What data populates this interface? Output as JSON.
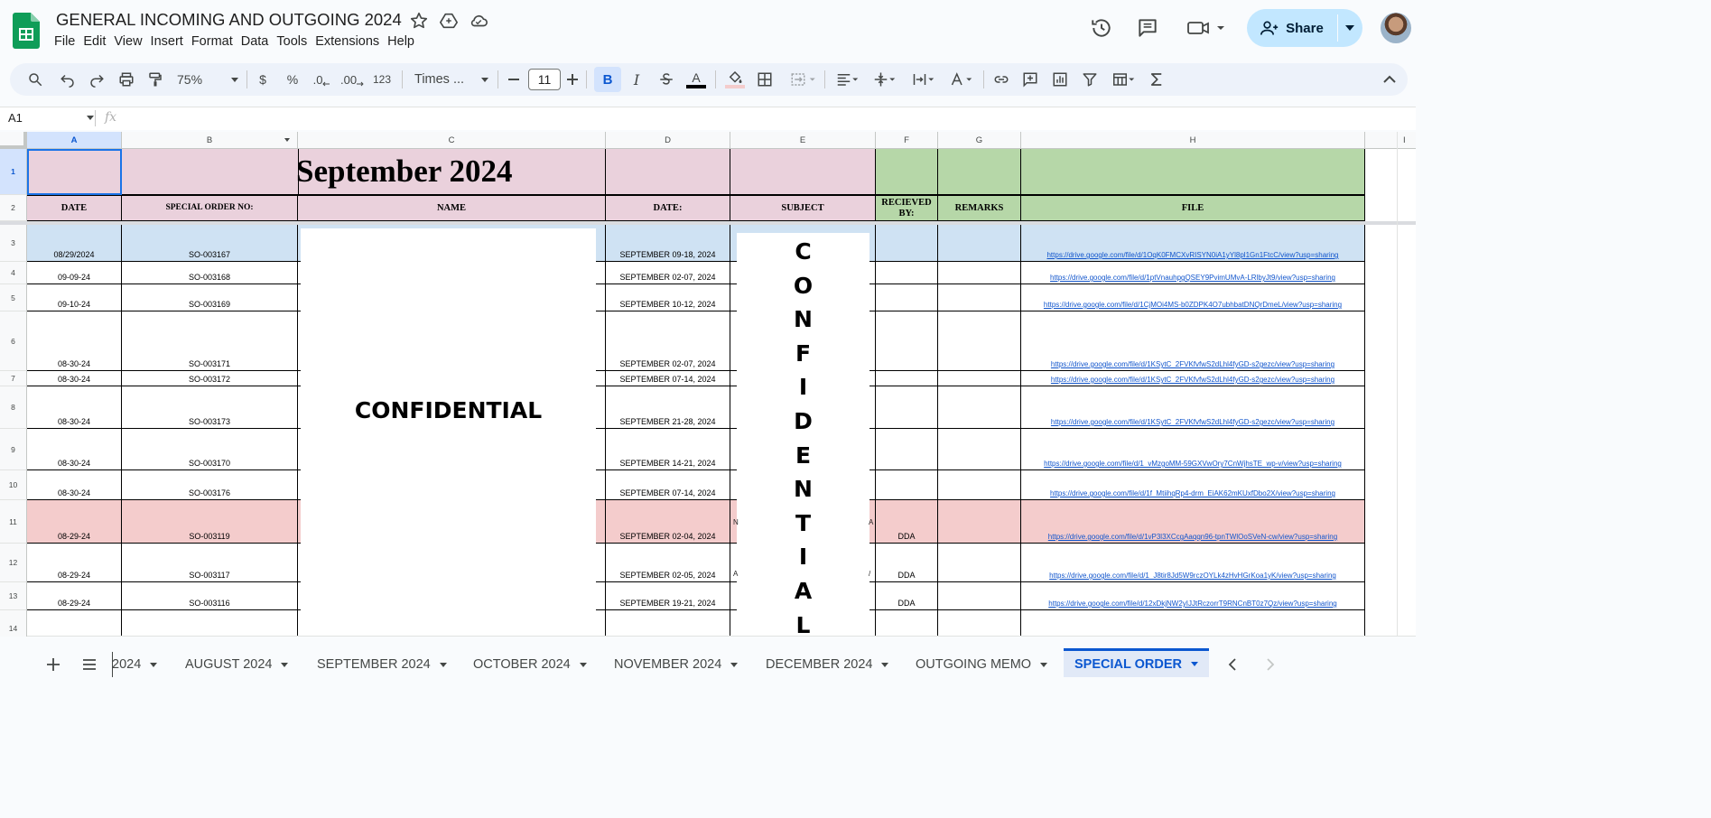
{
  "app": {
    "title": "GENERAL INCOMING AND OUTGOING 2024",
    "menu": [
      "File",
      "Edit",
      "View",
      "Insert",
      "Format",
      "Data",
      "Tools",
      "Extensions",
      "Help"
    ],
    "share_label": "Share"
  },
  "toolbar": {
    "zoom": "75%",
    "currency": "$",
    "percent": "%",
    "dec_decrease": ".0",
    "dec_increase": ".00",
    "number_format": "123",
    "font": "Times ...",
    "font_size": "11",
    "bold": "B",
    "italic": "I",
    "text_color": "A"
  },
  "formula_bar": {
    "name_box": "A1",
    "fx": "fx"
  },
  "columns": [
    "A",
    "B",
    "C",
    "D",
    "E",
    "F",
    "G",
    "H",
    "I"
  ],
  "rows": [
    "1",
    "2",
    "3",
    "4",
    "5",
    "6",
    "7",
    "8",
    "9",
    "10",
    "11",
    "12",
    "13",
    "14"
  ],
  "sheet": {
    "title": "September 2024",
    "headers": {
      "date": "DATE",
      "so_no": "SPECIAL ORDER NO:",
      "name": "NAME",
      "date2": "DATE:",
      "subject": "SUBJECT",
      "received_by": "RECIEVED BY:",
      "remarks": "REMARKS",
      "file": "FILE"
    },
    "confidential_name": "CONFIDENTIAL",
    "confidential_vertical": [
      "C",
      "O",
      "N",
      "F",
      "I",
      "D",
      "E",
      "N",
      "T",
      "I",
      "A",
      "L"
    ],
    "records": [
      {
        "date": "08/29/2024",
        "so": "SO-003167",
        "date2": "SEPTEMBER 09-18, 2024",
        "received": "",
        "link": "https://drive.google.com/file/d/1OqK0FMCXvRISYN0iA1yYl8pl1Gn1FtcC/view?usp=sharing"
      },
      {
        "date": "09-09-24",
        "so": "SO-003168",
        "date2": "SEPTEMBER 02-07, 2024",
        "received": "",
        "link": "https://drive.google.com/file/d/1ptVnauhpgQSEY9PvimUMvA-LRlbyJt9/view?usp=sharing"
      },
      {
        "date": "09-10-24",
        "so": "SO-003169",
        "date2": "SEPTEMBER 10-12, 2024",
        "received": "",
        "link": "https://drive.google.com/file/d/1CjMOi4MS-b0ZDPK4O7ubhbatDNQrDmeL/view?usp=sharing"
      },
      {
        "date": "08-30-24",
        "so": "SO-003171",
        "date2": "SEPTEMBER 02-07, 2024",
        "received": "",
        "link": "https://drive.google.com/file/d/1KSytC_2FVKfvfwS2dLhl4fyGD-s2gezc/view?usp=sharing"
      },
      {
        "date": "08-30-24",
        "so": "SO-003172",
        "date2": "SEPTEMBER 07-14, 2024",
        "received": "",
        "link": "https://drive.google.com/file/d/1KSytC_2FVKfvfwS2dLhl4fyGD-s2gezc/view?usp=sharing"
      },
      {
        "date": "08-30-24",
        "so": "SO-003173",
        "date2": "SEPTEMBER 21-28, 2024",
        "received": "",
        "link": "https://drive.google.com/file/d/1KSytC_2FVKfvfwS2dLhl4fyGD-s2gezc/view?usp=sharing"
      },
      {
        "date": "08-30-24",
        "so": "SO-003170",
        "date2": "SEPTEMBER 14-21, 2024",
        "received": "",
        "link": "https://drive.google.com/file/d/1_vMzgoMM-59GXVwOry7CnWjhsTE_wp-v/view?usp=sharing"
      },
      {
        "date": "08-30-24",
        "so": "SO-003176",
        "date2": "SEPTEMBER 07-14, 2024",
        "received": "",
        "link": "https://drive.google.com/file/d/1f_MtiihqRp4-drm_EiAK62mKUxfDbo2X/view?usp=sharing"
      },
      {
        "date": "08-29-24",
        "so": "SO-003119",
        "date2": "SEPTEMBER 02-04, 2024",
        "received": "DDA",
        "link": "https://drive.google.com/file/d/1vP3l3XCcgAaqqn96-tpnTWlOoSVeN-cw/view?usp=sharing"
      },
      {
        "date": "08-29-24",
        "so": "SO-003117",
        "date2": "SEPTEMBER 02-05, 2024",
        "received": "DDA",
        "link": "https://drive.google.com/file/d/1_J8tir8Jd5W9rczOYLk4zHvHGrKoa1yK/view?usp=sharing"
      },
      {
        "date": "08-29-24",
        "so": "SO-003116",
        "date2": "SEPTEMBER 19-21, 2024",
        "received": "DDA",
        "link": "https://drive.google.com/file/d/12xDkjNW2yIJJtRczorrT9RNCnBT0z7Qz/view?usp=sharing"
      }
    ],
    "subject_fragments": {
      "row11_left": "N",
      "row11_right": "A",
      "row12_left": "A",
      "row12_right": "/"
    }
  },
  "tabs": [
    "2024",
    "AUGUST 2024",
    "SEPTEMBER 2024",
    "OCTOBER 2024",
    "NOVEMBER 2024",
    "DECEMBER 2024",
    "OUTGOING MEMO",
    "SPECIAL ORDER"
  ],
  "active_tab": "SPECIAL ORDER",
  "colors": {
    "header_pink": "#ead1dc",
    "header_green": "#b6d7a8",
    "row_blue": "#cfe2f3",
    "row_red": "#f4cccc",
    "accent": "#0b57d0",
    "share_bg": "#c2e7ff"
  }
}
